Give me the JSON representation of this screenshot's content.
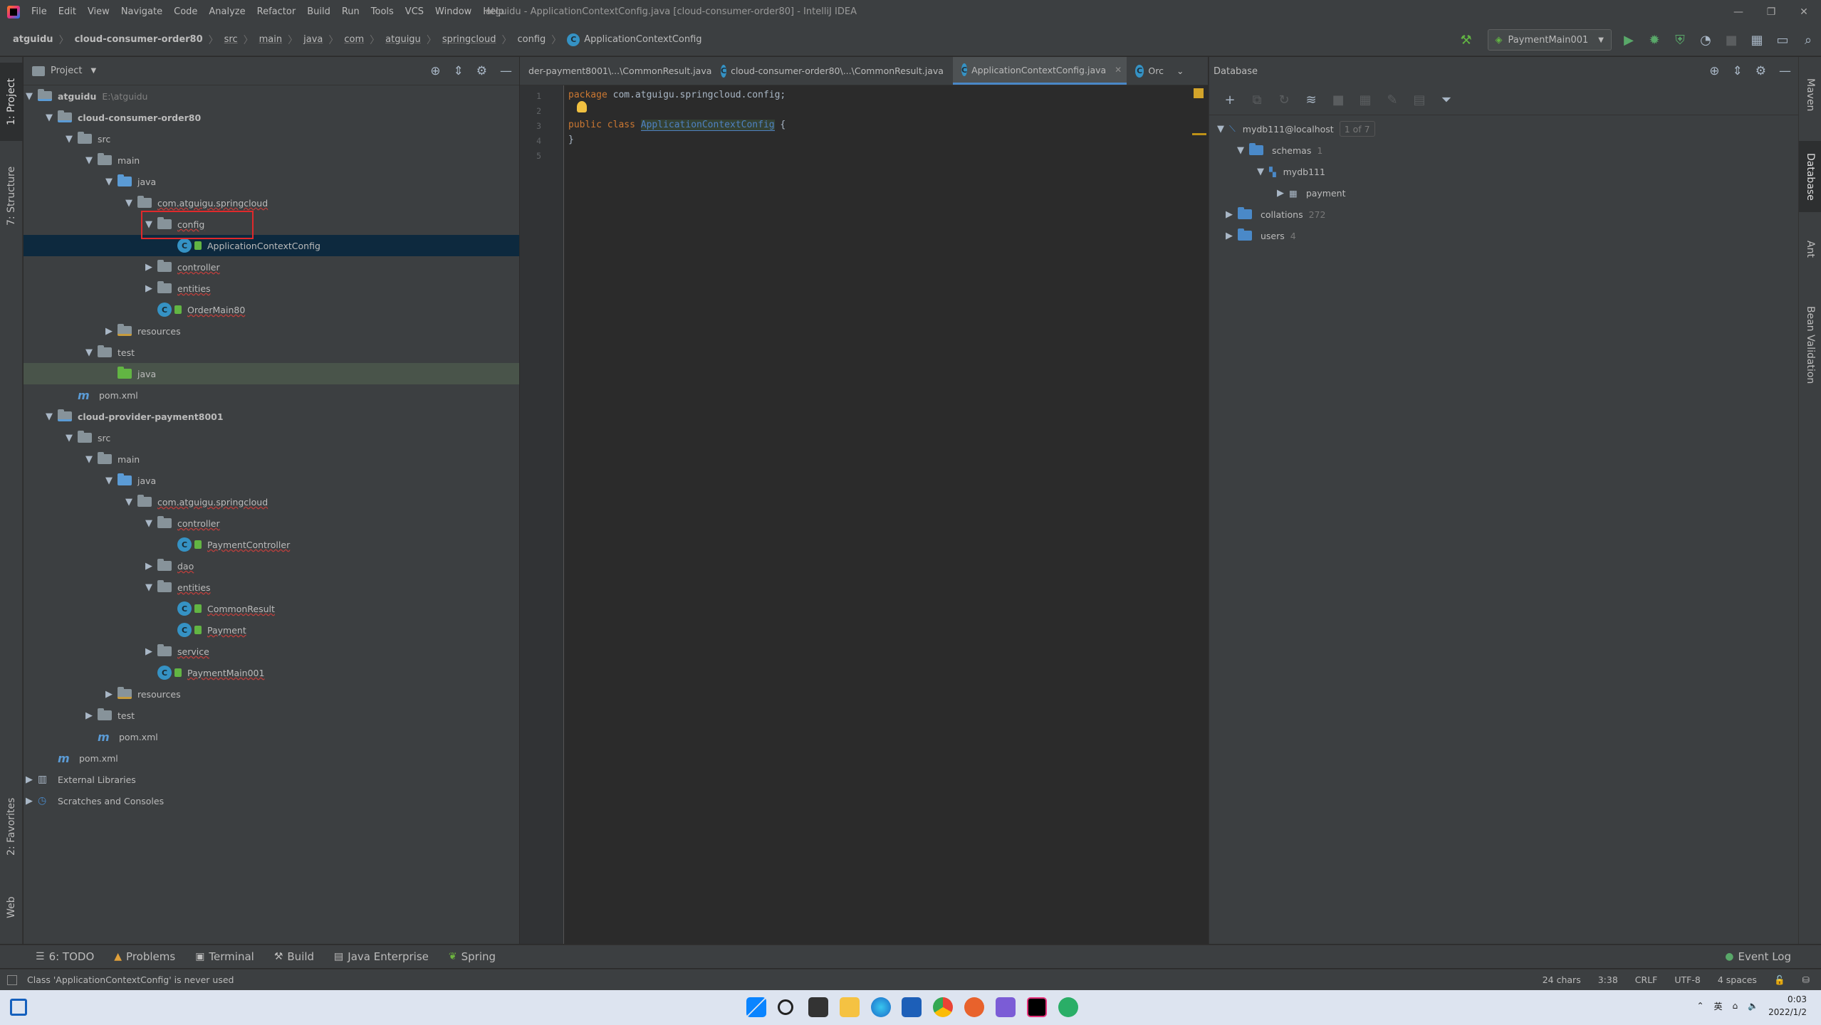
{
  "window": {
    "title": "atguidu - ApplicationContextConfig.java [cloud-consumer-order80] - IntelliJ IDEA",
    "menu": [
      "File",
      "Edit",
      "View",
      "Navigate",
      "Code",
      "Analyze",
      "Refactor",
      "Build",
      "Run",
      "Tools",
      "VCS",
      "Window",
      "Help"
    ]
  },
  "breadcrumb": [
    "atguidu",
    "cloud-consumer-order80",
    "src",
    "main",
    "java",
    "com",
    "atguigu",
    "springcloud",
    "config",
    "ApplicationContextConfig"
  ],
  "toolbar": {
    "run_config": "PaymentMain001"
  },
  "left_strip": {
    "project": "1: Project",
    "structure": "7: Structure",
    "favorites": "2: Favorites",
    "web": "Web"
  },
  "right_strip": {
    "maven": "Maven",
    "database": "Database",
    "ant": "Ant",
    "bean": "Bean Validation"
  },
  "project": {
    "title": "Project",
    "tree": [
      {
        "label": "atguidu",
        "extra": "E:\\atguidu",
        "depth": 0,
        "icon": "module",
        "arrow": "open",
        "bold": true
      },
      {
        "label": "cloud-consumer-order80",
        "depth": 1,
        "icon": "module",
        "arrow": "open",
        "bold": true
      },
      {
        "label": "src",
        "depth": 2,
        "icon": "folder",
        "arrow": "open"
      },
      {
        "label": "main",
        "depth": 3,
        "icon": "folder",
        "arrow": "open"
      },
      {
        "label": "java",
        "depth": 4,
        "icon": "blue",
        "arrow": "open"
      },
      {
        "label": "com.atguigu.springcloud",
        "depth": 5,
        "icon": "pkg",
        "arrow": "open"
      },
      {
        "label": "config",
        "depth": 6,
        "icon": "pkg",
        "arrow": "open"
      },
      {
        "label": "ApplicationContextConfig",
        "depth": 7,
        "icon": "class",
        "arrow": "none",
        "selected": true
      },
      {
        "label": "controller",
        "depth": 6,
        "icon": "pkg",
        "arrow": "closed"
      },
      {
        "label": "entities",
        "depth": 6,
        "icon": "pkg",
        "arrow": "closed"
      },
      {
        "label": "OrderMain80",
        "depth": 6,
        "icon": "runclass",
        "arrow": "none"
      },
      {
        "label": "resources",
        "depth": 4,
        "icon": "res",
        "arrow": "closed"
      },
      {
        "label": "test",
        "depth": 3,
        "icon": "folder",
        "arrow": "open"
      },
      {
        "label": "java",
        "depth": 4,
        "icon": "green",
        "arrow": "none",
        "highlight": true
      },
      {
        "label": "pom.xml",
        "depth": 2,
        "icon": "maven",
        "arrow": "none"
      },
      {
        "label": "cloud-provider-payment8001",
        "depth": 1,
        "icon": "module",
        "arrow": "open",
        "bold": true
      },
      {
        "label": "src",
        "depth": 2,
        "icon": "folder",
        "arrow": "open"
      },
      {
        "label": "main",
        "depth": 3,
        "icon": "folder",
        "arrow": "open"
      },
      {
        "label": "java",
        "depth": 4,
        "icon": "blue",
        "arrow": "open"
      },
      {
        "label": "com.atguigu.springcloud",
        "depth": 5,
        "icon": "pkg",
        "arrow": "open"
      },
      {
        "label": "controller",
        "depth": 6,
        "icon": "pkg",
        "arrow": "open"
      },
      {
        "label": "PaymentController",
        "depth": 7,
        "icon": "class",
        "arrow": "none"
      },
      {
        "label": "dao",
        "depth": 6,
        "icon": "pkg",
        "arrow": "closed"
      },
      {
        "label": "entities",
        "depth": 6,
        "icon": "pkg",
        "arrow": "open"
      },
      {
        "label": "CommonResult",
        "depth": 7,
        "icon": "class",
        "arrow": "none"
      },
      {
        "label": "Payment",
        "depth": 7,
        "icon": "class",
        "arrow": "none"
      },
      {
        "label": "service",
        "depth": 6,
        "icon": "pkg",
        "arrow": "closed"
      },
      {
        "label": "PaymentMain001",
        "depth": 6,
        "icon": "runclass",
        "arrow": "none"
      },
      {
        "label": "resources",
        "depth": 4,
        "icon": "res",
        "arrow": "closed"
      },
      {
        "label": "test",
        "depth": 3,
        "icon": "folder",
        "arrow": "closed"
      },
      {
        "label": "pom.xml",
        "depth": 3,
        "icon": "maven",
        "arrow": "none"
      },
      {
        "label": "pom.xml",
        "depth": 1,
        "icon": "maven",
        "arrow": "none"
      },
      {
        "label": "External Libraries",
        "depth": 0,
        "icon": "lib",
        "arrow": "closed"
      },
      {
        "label": "Scratches and Consoles",
        "depth": 0,
        "icon": "scratch",
        "arrow": "closed"
      }
    ]
  },
  "editor": {
    "tabs": [
      {
        "label": "der-payment8001\\...\\CommonResult.java",
        "active": false
      },
      {
        "label": "cloud-consumer-order80\\...\\CommonResult.java",
        "active": false
      },
      {
        "label": "ApplicationContextConfig.java",
        "active": true
      },
      {
        "label": "Orc",
        "active": false
      }
    ],
    "lines": [
      "1",
      "2",
      "3",
      "4",
      "5"
    ],
    "code": {
      "line1_kw": "package",
      "line1_rest": " com.atguigu.springcloud.config;",
      "line3_kw1": "public",
      "line3_kw2": "class",
      "line3_name": "ApplicationContextConfig",
      "line3_rest": " {",
      "line4": "}"
    }
  },
  "database": {
    "title": "Database",
    "root": {
      "label": "mydb111@localhost",
      "badge": "1 of 7"
    },
    "schemas": {
      "label": "schemas",
      "count": "1"
    },
    "schema": {
      "label": "mydb111"
    },
    "table": {
      "label": "payment"
    },
    "collations": {
      "label": "collations",
      "count": "272"
    },
    "users": {
      "label": "users",
      "count": "4"
    }
  },
  "bottom_tabs": [
    "6: TODO",
    "Problems",
    "Terminal",
    "Build",
    "Java Enterprise",
    "Spring"
  ],
  "event_log": "Event Log",
  "status": {
    "message": "Class 'ApplicationContextConfig' is never used",
    "chars": "24 chars",
    "position": "3:38",
    "line_sep": "CRLF",
    "encoding": "UTF-8",
    "indent": "4 spaces"
  },
  "taskbar": {
    "time": "0:03",
    "date": "2022/1/2",
    "lang": "英"
  }
}
